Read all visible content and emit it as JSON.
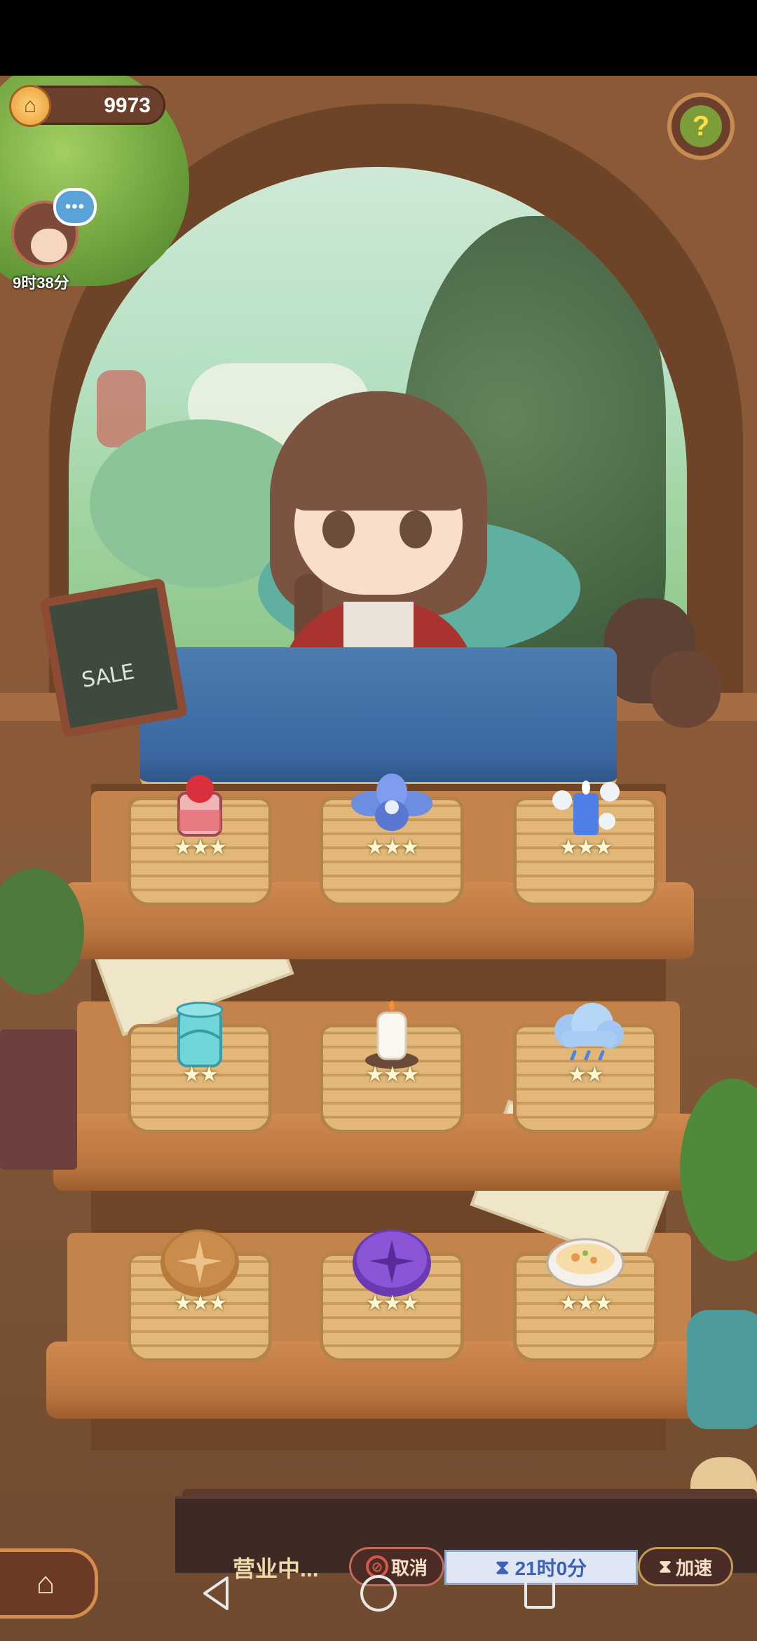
{
  "hud": {
    "coins": "9973",
    "customer_timer": "9时38分",
    "chat_indicator": "•••",
    "help_symbol": "?"
  },
  "counter": {
    "sign_text": "SALE"
  },
  "shelves": [
    {
      "items": [
        {
          "name": "red-jam-jar",
          "stars": "★★★",
          "rating": 3
        },
        {
          "name": "blue-flower",
          "stars": "★★★",
          "rating": 3
        },
        {
          "name": "blue-candle",
          "stars": "★★★",
          "rating": 3
        }
      ]
    },
    {
      "items": [
        {
          "name": "teal-jar",
          "stars": "★★",
          "rating": 2
        },
        {
          "name": "white-candle",
          "stars": "★★★",
          "rating": 3
        },
        {
          "name": "rain-cloud",
          "stars": "★★",
          "rating": 2
        }
      ]
    },
    {
      "items": [
        {
          "name": "bread-loaf",
          "stars": "★★★",
          "rating": 3
        },
        {
          "name": "purple-bread",
          "stars": "★★★",
          "rating": 3
        },
        {
          "name": "soup-bowl",
          "stars": "★★★",
          "rating": 3
        }
      ]
    }
  ],
  "bottom_bar": {
    "status": "营业中...",
    "cancel_label": "取消",
    "time_remaining": "21时0分",
    "speed_label": "加速"
  },
  "colors": {
    "cloth": "#3b67a0",
    "wood": "#c4834b",
    "time_text": "#3b61b8"
  }
}
